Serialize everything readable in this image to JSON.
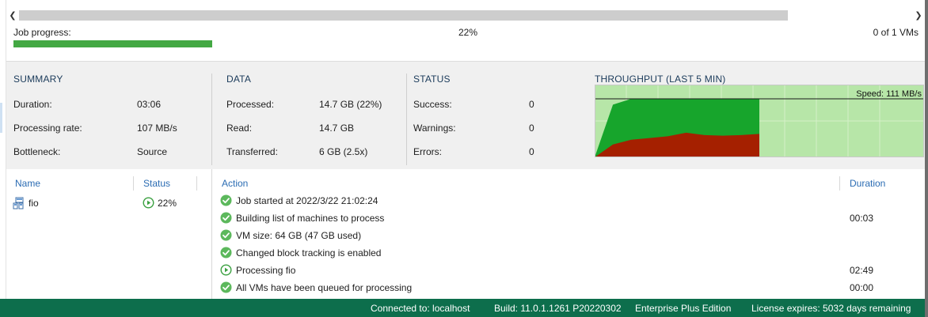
{
  "job_progress": {
    "label": "Job progress:",
    "percent_text": "22%",
    "percent": 22,
    "count_text": "0 of 1 VMs"
  },
  "summary": {
    "title": "SUMMARY",
    "rows": [
      {
        "label": "Duration:",
        "value": "03:06"
      },
      {
        "label": "Processing rate:",
        "value": "107 MB/s"
      },
      {
        "label": "Bottleneck:",
        "value": "Source"
      }
    ]
  },
  "data_section": {
    "title": "DATA",
    "rows": [
      {
        "label": "Processed:",
        "value": "14.7 GB (22%)"
      },
      {
        "label": "Read:",
        "value": "14.7 GB"
      },
      {
        "label": "Transferred:",
        "value": "6 GB (2.5x)"
      }
    ]
  },
  "status_section": {
    "title": "STATUS",
    "rows": [
      {
        "label": "Success:",
        "value": "0"
      },
      {
        "label": "Warnings:",
        "value": "0"
      },
      {
        "label": "Errors:",
        "value": "0"
      }
    ]
  },
  "throughput": {
    "title": "THROUGHPUT (LAST 5 MIN)",
    "speed_label": "Speed: 111 MB/s",
    "colors": {
      "background": "#b7e6a8",
      "grid": "#d4f0c8",
      "processed": "#17a52c",
      "read": "#a52000"
    }
  },
  "chart_data": {
    "type": "area",
    "title": "THROUGHPUT (LAST 5 MIN)",
    "x": [
      0,
      1,
      2,
      3,
      4,
      5,
      6,
      7,
      8,
      9
    ],
    "series": [
      {
        "values": [
          0,
          90,
          100,
          100,
          100,
          100,
          100,
          100,
          100,
          100
        ]
      },
      {
        "values": [
          0,
          22,
          30,
          33,
          36,
          42,
          38,
          37,
          38,
          40
        ]
      }
    ],
    "annotations": [
      "Speed: 111 MB/s"
    ],
    "ylim": [
      0,
      100
    ],
    "grid": true
  },
  "vm_table": {
    "headers": {
      "name": "Name",
      "status": "Status"
    },
    "rows": [
      {
        "name": "fio",
        "status": "22%"
      }
    ]
  },
  "action_table": {
    "headers": {
      "action": "Action",
      "duration": "Duration"
    },
    "rows": [
      {
        "icon": "success-check-icon",
        "text": "Job started at 2022/3/22 21:02:24",
        "duration": ""
      },
      {
        "icon": "success-check-icon",
        "text": "Building list of machines to process",
        "duration": "00:03"
      },
      {
        "icon": "success-check-icon",
        "text": "VM size: 64 GB (47 GB used)",
        "duration": ""
      },
      {
        "icon": "success-check-icon",
        "text": "Changed block tracking is enabled",
        "duration": ""
      },
      {
        "icon": "in-progress-play-icon",
        "text": "Processing fio",
        "duration": "02:49"
      },
      {
        "icon": "success-check-icon",
        "text": "All VMs have been queued for processing",
        "duration": "00:00"
      }
    ]
  },
  "status_bar": {
    "connected": "Connected to: localhost",
    "build": "Build: 11.0.1.1261 P20220302",
    "edition": "Enterprise Plus Edition",
    "license": "License expires: 5032 days remaining"
  },
  "colors": {
    "accent_green": "#43a843",
    "status_bar": "#0d6e4c",
    "header_blue": "#2b6cb3",
    "check_green": "#5cb85c"
  }
}
